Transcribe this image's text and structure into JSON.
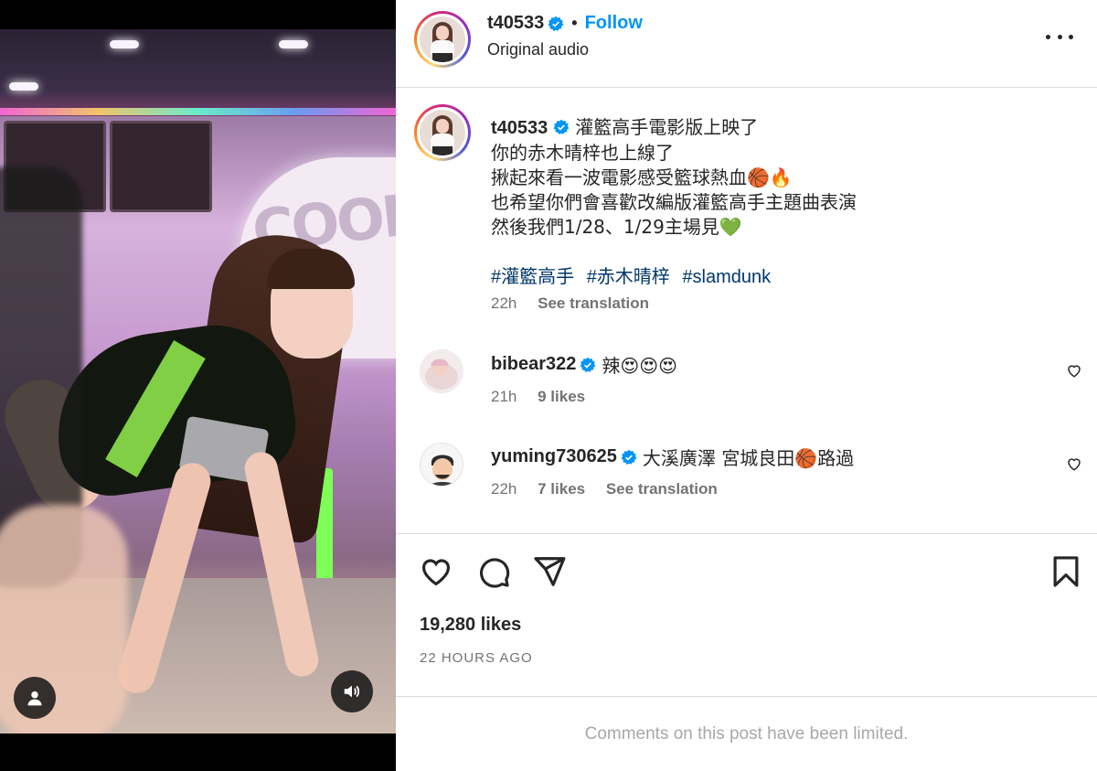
{
  "author": {
    "username": "t40533",
    "verified": true,
    "follow_label": "Follow",
    "separator": "•",
    "audio": "Original audio"
  },
  "caption": {
    "username": "t40533",
    "lines": [
      "灌籃高手電影版上映了",
      "你的赤木晴梓也上線了",
      "揪起來看一波電影感受籃球熱血🏀🔥",
      "也希望你們會喜歡改編版灌籃高手主題曲表演",
      "然後我們1/28、1/29主場見💚"
    ],
    "hashtags": [
      "#灌籃高手",
      "#赤木晴梓",
      "#slamdunk"
    ],
    "time": "22h",
    "see_translation": "See translation"
  },
  "comments": [
    {
      "username": "bibear322",
      "verified": true,
      "text": "辣😍😍😍",
      "time": "21h",
      "likes": "9 likes"
    },
    {
      "username": "yuming730625",
      "verified": true,
      "text": "大溪廣澤 宮城良田🏀路過",
      "time": "22h",
      "likes": "7 likes",
      "see_translation": "See translation"
    }
  ],
  "engagement": {
    "likes": "19,280 likes",
    "posted": "22 HOURS AGO"
  },
  "footer": {
    "limited": "Comments on this post have been limited."
  },
  "video": {
    "sign_text": "COOL"
  },
  "colors": {
    "link_blue": "#0095f6",
    "hashtag": "#00376b",
    "verified": "#0095f6",
    "muted": "#737373"
  }
}
